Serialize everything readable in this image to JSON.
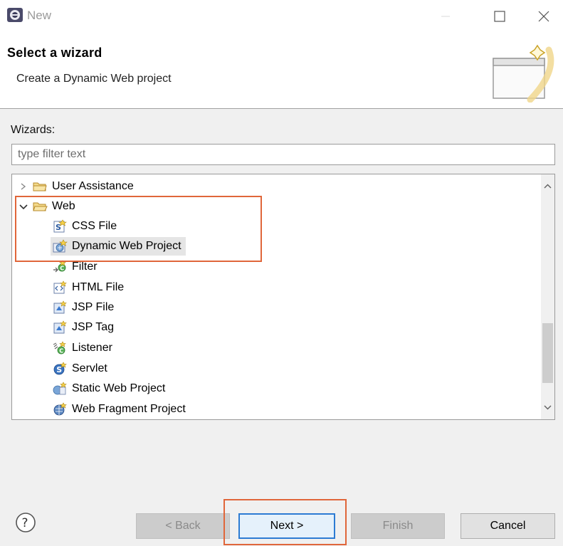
{
  "window": {
    "title": "New"
  },
  "banner": {
    "title": "Select a wizard",
    "subtitle": "Create a Dynamic Web project"
  },
  "wizards": {
    "label": "Wizards:",
    "filter_placeholder": "type filter text",
    "filter_value": ""
  },
  "tree": {
    "items": [
      {
        "label": "User Assistance",
        "icon": "folder-icon",
        "expanded": false,
        "level": 0
      },
      {
        "label": "Web",
        "icon": "folder-open-icon",
        "expanded": true,
        "level": 0
      },
      {
        "label": "CSS File",
        "icon": "css-file-icon",
        "level": 1
      },
      {
        "label": "Dynamic Web Project",
        "icon": "dynamic-web-project-icon",
        "level": 1,
        "selected": true
      },
      {
        "label": "Filter",
        "icon": "filter-icon",
        "level": 1
      },
      {
        "label": "HTML File",
        "icon": "html-file-icon",
        "level": 1
      },
      {
        "label": "JSP File",
        "icon": "jsp-file-icon",
        "level": 1
      },
      {
        "label": "JSP Tag",
        "icon": "jsp-tag-icon",
        "level": 1
      },
      {
        "label": "Listener",
        "icon": "listener-icon",
        "level": 1
      },
      {
        "label": "Servlet",
        "icon": "servlet-icon",
        "level": 1
      },
      {
        "label": "Static Web Project",
        "icon": "static-web-project-icon",
        "level": 1
      },
      {
        "label": "Web Fragment Project",
        "icon": "web-fragment-project-icon",
        "level": 1
      }
    ]
  },
  "buttons": {
    "back": "< Back",
    "next": "Next >",
    "finish": "Finish",
    "cancel": "Cancel"
  },
  "colors": {
    "highlight": "#e0663a",
    "primary_border": "#2c7bd3",
    "selection": "#e5e5e5"
  }
}
